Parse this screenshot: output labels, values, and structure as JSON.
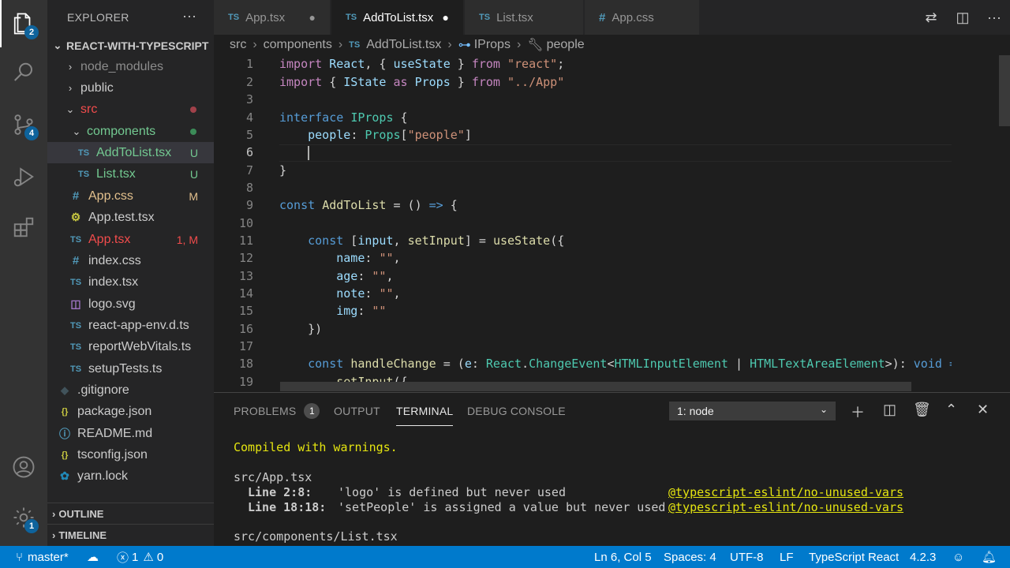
{
  "activity_bar": {
    "explorer_badge": "2",
    "scm_badge": "4",
    "settings_badge": "1"
  },
  "sidebar": {
    "title": "EXPLORER",
    "more": "···",
    "project": "REACT-WITH-TYPESCRIPT",
    "items": [
      {
        "label": "node_modules",
        "kind": "folder",
        "color": "#8c8c8c"
      },
      {
        "label": "public",
        "kind": "folder",
        "color": "#cccccc"
      },
      {
        "label": "src",
        "kind": "folder-open",
        "color": "#f14c4c"
      },
      {
        "label": "components",
        "kind": "folder-open",
        "color": "#73c991"
      },
      {
        "label": "AddToList.tsx",
        "kind": "file",
        "icon": "TS",
        "color": "#73c991",
        "decoration": "U"
      },
      {
        "label": "List.tsx",
        "kind": "file",
        "icon": "TS",
        "color": "#73c991",
        "decoration": "U"
      },
      {
        "label": "App.css",
        "kind": "file",
        "icon": "#",
        "color": "#e2c08d",
        "decoration": "M"
      },
      {
        "label": "App.test.tsx",
        "kind": "file",
        "icon": "gear",
        "color": "#cccccc"
      },
      {
        "label": "App.tsx",
        "kind": "file",
        "icon": "TS",
        "color": "#f14c4c",
        "decoration": "1, M"
      },
      {
        "label": "index.css",
        "kind": "file",
        "icon": "#",
        "color": "#cccccc"
      },
      {
        "label": "index.tsx",
        "kind": "file",
        "icon": "TS",
        "color": "#cccccc"
      },
      {
        "label": "logo.svg",
        "kind": "file",
        "icon": "svg",
        "color": "#cccccc"
      },
      {
        "label": "react-app-env.d.ts",
        "kind": "file",
        "icon": "TS",
        "color": "#cccccc"
      },
      {
        "label": "reportWebVitals.ts",
        "kind": "file",
        "icon": "TS",
        "color": "#cccccc"
      },
      {
        "label": "setupTests.ts",
        "kind": "file",
        "icon": "TS",
        "color": "#cccccc"
      },
      {
        "label": ".gitignore",
        "kind": "file",
        "icon": "git",
        "color": "#cccccc"
      },
      {
        "label": "package.json",
        "kind": "file",
        "icon": "{}",
        "color": "#cccccc"
      },
      {
        "label": "README.md",
        "kind": "file",
        "icon": "info",
        "color": "#cccccc"
      },
      {
        "label": "tsconfig.json",
        "kind": "file",
        "icon": "{}",
        "color": "#cccccc"
      },
      {
        "label": "yarn.lock",
        "kind": "file",
        "icon": "yarn",
        "color": "#cccccc"
      }
    ],
    "outline": "OUTLINE",
    "timeline": "TIMELINE"
  },
  "tabs": [
    {
      "label": "App.tsx",
      "icon": "TS",
      "dirty": true
    },
    {
      "label": "AddToList.tsx",
      "icon": "TS",
      "dirty": true,
      "active": true
    },
    {
      "label": "List.tsx",
      "icon": "TS"
    },
    {
      "label": "App.css",
      "icon": "#"
    }
  ],
  "breadcrumbs": [
    "src",
    "components",
    "AddToList.tsx",
    "IProps",
    "people"
  ],
  "editor": {
    "line_numbers": [
      "1",
      "2",
      "3",
      "4",
      "5",
      "6",
      "7",
      "8",
      "9",
      "10",
      "11",
      "12",
      "13",
      "14",
      "15",
      "16",
      "17",
      "18",
      "19"
    ],
    "current_line": 6
  },
  "panel": {
    "tabs": [
      "PROBLEMS",
      "OUTPUT",
      "TERMINAL",
      "DEBUG CONSOLE"
    ],
    "problems_count": "1",
    "terminal_select": "1: node",
    "terminal": {
      "line1": "Compiled with warnings.",
      "file1": "src/App.tsx",
      "w1_loc": "Line 2:8:",
      "w1_msg": "'logo' is defined but never used",
      "w1_rule": "@typescript-eslint/no-unused-vars",
      "w2_loc": "Line 18:18:",
      "w2_msg": "'setPeople' is assigned a value but never used",
      "w2_rule": "@typescript-eslint/no-unused-vars",
      "file2": "src/components/List.tsx"
    }
  },
  "status": {
    "branch": "master*",
    "errors": "1",
    "warnings": "0",
    "position": "Ln 6, Col 5",
    "spaces": "Spaces: 4",
    "encoding": "UTF-8",
    "eol": "LF",
    "language": "TypeScript React",
    "version": "4.2.3"
  }
}
